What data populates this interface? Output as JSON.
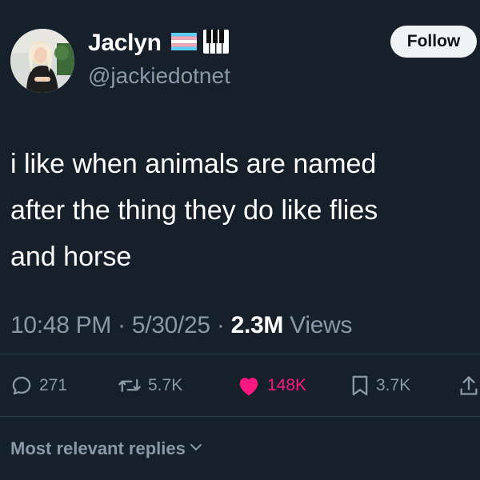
{
  "author": {
    "display_name": "Jaclyn",
    "handle": "@jackiedotnet",
    "badges": [
      "transgender-flag-icon",
      "piano-keys-icon"
    ]
  },
  "follow_button": {
    "label": "Follow"
  },
  "tweet": {
    "lines": [
      "i like when animals are named",
      "after the thing they do like flies",
      "and horse"
    ]
  },
  "meta": {
    "time": "10:48 PM",
    "separator": "·",
    "date": "5/30/25",
    "views_count": "2.3M",
    "views_label": "Views"
  },
  "actions": {
    "replies": "271",
    "reposts": "5.7K",
    "likes": "148K",
    "bookmarks": "3.7K"
  },
  "replies_sort": {
    "label": "Most relevant replies"
  },
  "colors": {
    "background": "#15202b",
    "secondary_text": "#8b98a5",
    "like_pink": "#f91880",
    "follow_bg": "#eff3f4"
  }
}
